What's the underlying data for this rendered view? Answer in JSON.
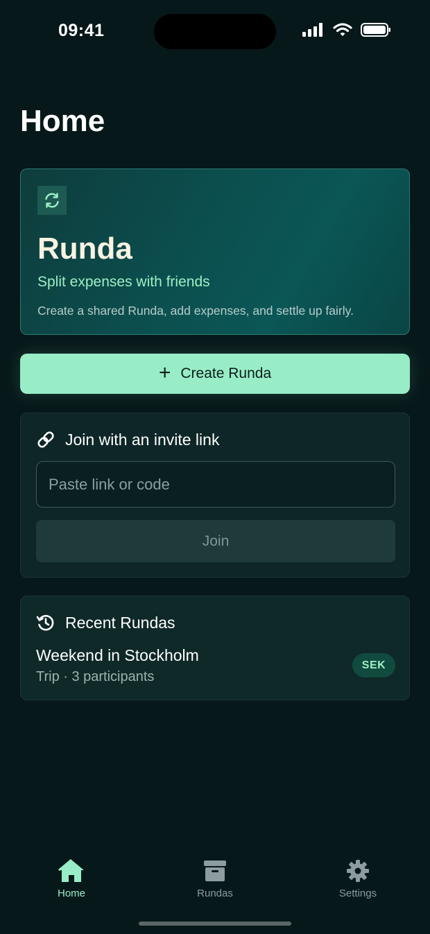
{
  "status_bar": {
    "time": "09:41"
  },
  "page": {
    "title": "Home"
  },
  "hero": {
    "icon": "refresh-icon",
    "title": "Runda",
    "subtitle": "Split expenses with friends",
    "description": "Create a shared Runda, add expenses, and settle up fairly."
  },
  "create_button": {
    "icon": "plus-icon",
    "label": "Create Runda"
  },
  "join": {
    "icon": "link-icon",
    "title": "Join with an invite link",
    "input_value": "",
    "input_placeholder": "Paste link or code",
    "button_label": "Join"
  },
  "recent": {
    "icon": "history-icon",
    "title": "Recent Rundas",
    "items": [
      {
        "title": "Weekend in Stockholm",
        "meta": "Trip · 3 participants",
        "currency": "SEK"
      }
    ]
  },
  "tabs": [
    {
      "label": "Home",
      "icon": "home-icon",
      "active": true
    },
    {
      "label": "Rundas",
      "icon": "archive-icon",
      "active": false
    },
    {
      "label": "Settings",
      "icon": "gear-icon",
      "active": false
    }
  ],
  "colors": {
    "background": "#07181a",
    "accent": "#98edc6",
    "hero_gradient": "#0c4f4f",
    "card": "#0e2627",
    "badge_bg": "#114a3e"
  }
}
